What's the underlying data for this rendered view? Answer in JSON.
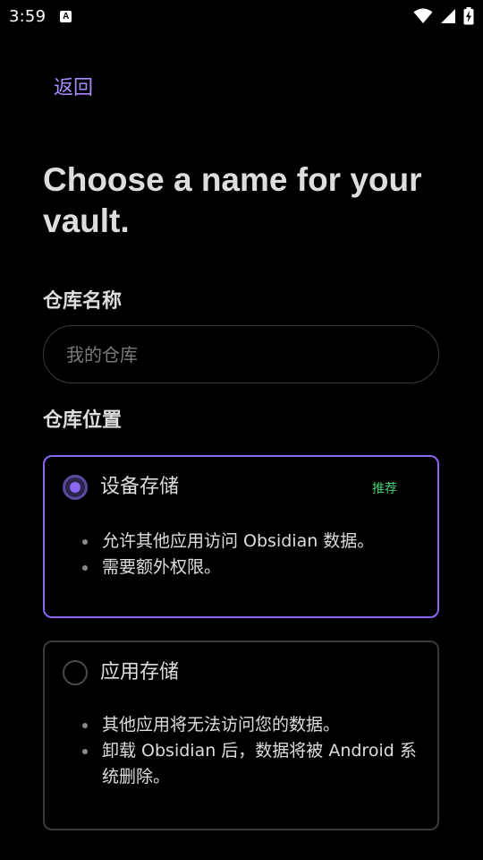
{
  "status_bar": {
    "time": "3:59",
    "notification_icon": "a-icon",
    "icons": [
      "wifi-icon",
      "signal-icon",
      "battery-charging-icon"
    ]
  },
  "back_label": "返回",
  "title": "Choose a name for your vault.",
  "vault_name": {
    "label": "仓库名称",
    "value": "",
    "placeholder": "我的仓库"
  },
  "vault_location": {
    "label": "仓库位置",
    "options": [
      {
        "title": "设备存储",
        "badge": "推荐",
        "selected": true,
        "bullets": [
          "允许其他应用访问 Obsidian 数据。",
          "需要额外权限。"
        ]
      },
      {
        "title": "应用存储",
        "selected": false,
        "bullets": [
          "其他应用将无法访问您的数据。",
          "卸载 Obsidian 后，数据将被 Android 系统删除。"
        ]
      }
    ]
  },
  "colors": {
    "accent": "#8a67f0",
    "accent_text": "#a88bfa",
    "recommended": "#44cf6e",
    "background": "#000000"
  }
}
